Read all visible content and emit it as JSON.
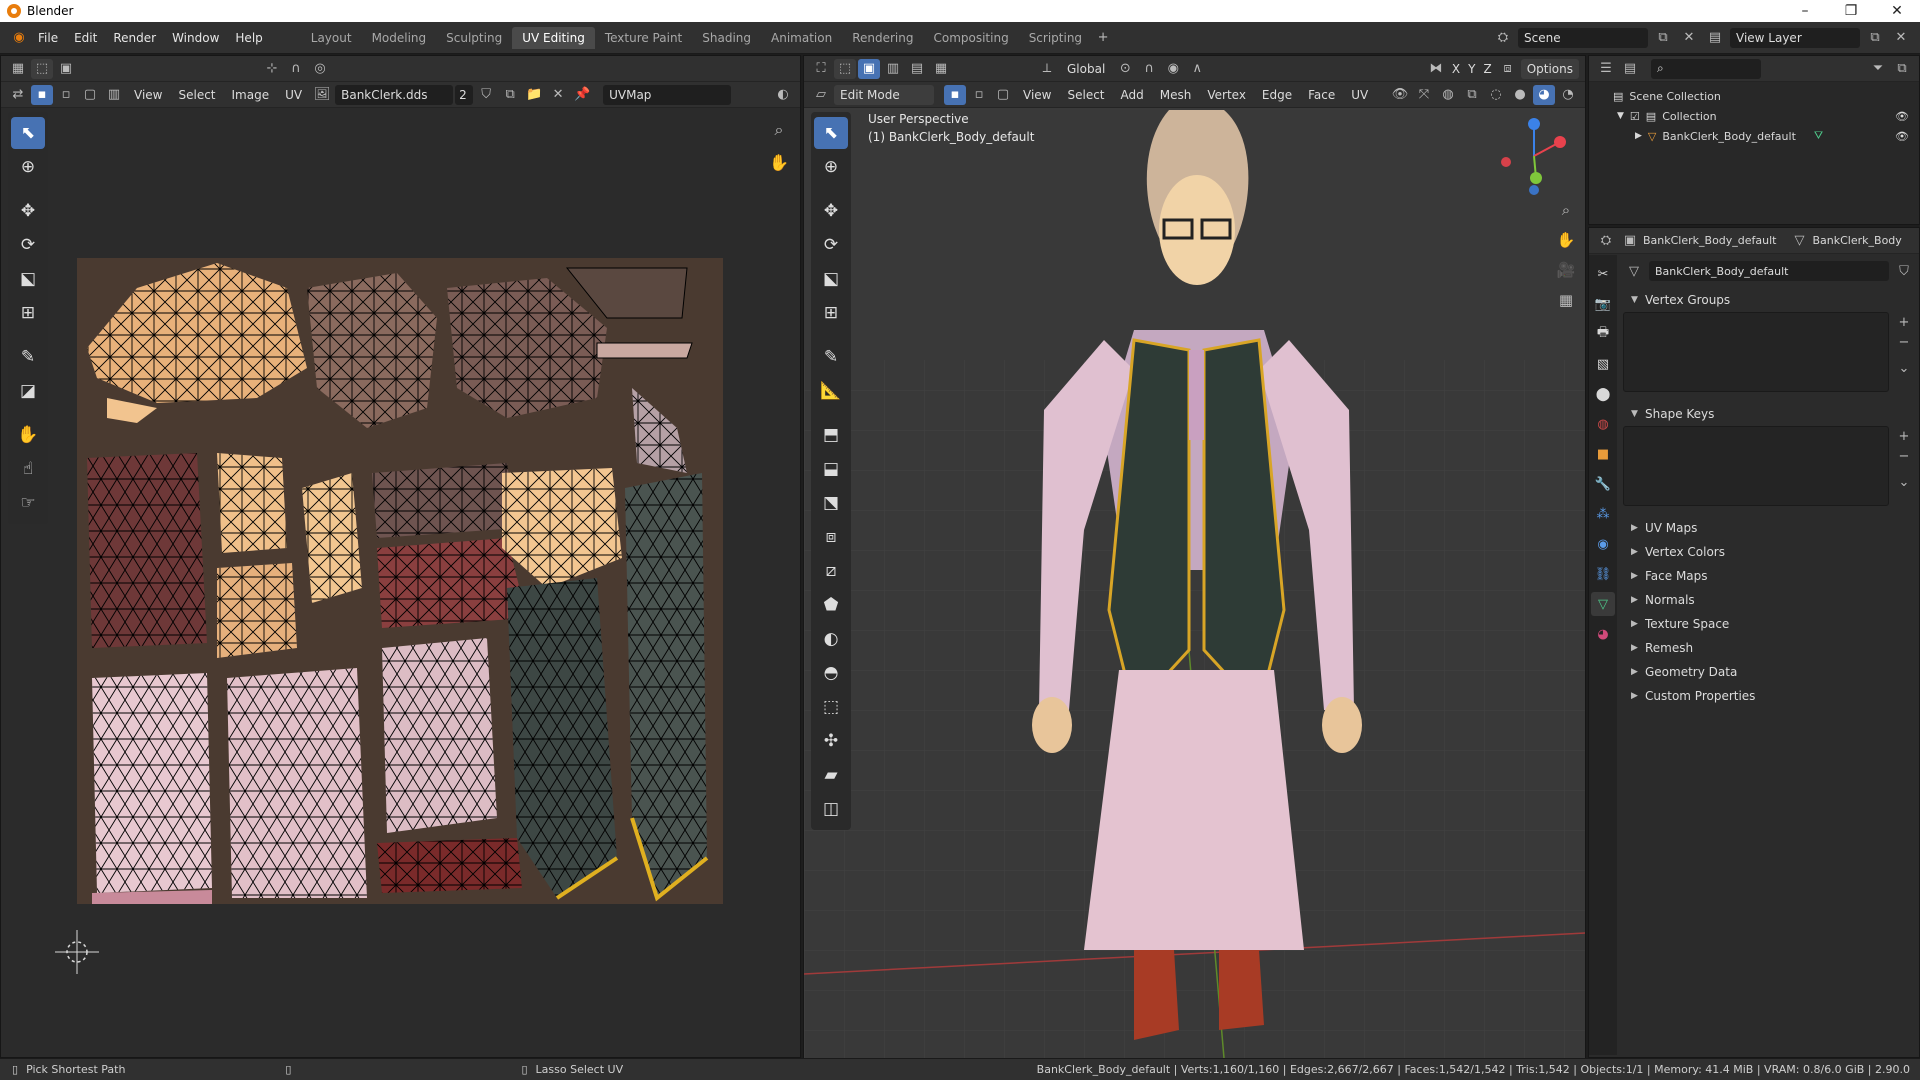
{
  "window": {
    "title": "Blender"
  },
  "menu": [
    "File",
    "Edit",
    "Render",
    "Window",
    "Help"
  ],
  "workspaces": [
    {
      "label": "Layout",
      "active": false
    },
    {
      "label": "Modeling",
      "active": false
    },
    {
      "label": "Sculpting",
      "active": false
    },
    {
      "label": "UV Editing",
      "active": true
    },
    {
      "label": "Texture Paint",
      "active": false
    },
    {
      "label": "Shading",
      "active": false
    },
    {
      "label": "Animation",
      "active": false
    },
    {
      "label": "Rendering",
      "active": false
    },
    {
      "label": "Compositing",
      "active": false
    },
    {
      "label": "Scripting",
      "active": false
    }
  ],
  "scene": {
    "label": "Scene",
    "view_layer": "View Layer"
  },
  "uv_editor": {
    "menus": [
      "View",
      "Select",
      "Image",
      "UV"
    ],
    "image_name": "BankClerk.dds",
    "image_users": "2",
    "uv_map": "UVMap"
  },
  "viewport": {
    "orientation": "Global",
    "options": "Options",
    "mode": "Edit Mode",
    "menus": [
      "View",
      "Select",
      "Add",
      "Mesh",
      "Vertex",
      "Edge",
      "Face",
      "UV"
    ],
    "overlay_line1": "User Perspective",
    "overlay_line2": "(1) BankClerk_Body_default",
    "axes": {
      "x": "X",
      "y": "Y",
      "z": "Z"
    }
  },
  "outliner": {
    "scene_collection": "Scene Collection",
    "collection": "Collection",
    "object": "BankClerk_Body_default"
  },
  "properties": {
    "breadcrumb_object": "BankClerk_Body_default",
    "breadcrumb_mesh": "BankClerk_Body",
    "mesh_name": "BankClerk_Body_default",
    "panels_open": [
      "Vertex Groups",
      "Shape Keys"
    ],
    "panels_closed": [
      "UV Maps",
      "Vertex Colors",
      "Face Maps",
      "Normals",
      "Texture Space",
      "Remesh",
      "Geometry Data",
      "Custom Properties"
    ]
  },
  "status": {
    "left": "Pick Shortest Path",
    "middle": "Lasso Select UV",
    "right": "BankClerk_Body_default | Verts:1,160/1,160 | Edges:2,667/2,667 | Faces:1,542/1,542 | Tris:1,542 | Objects:1/1 | Memory: 41.4 MiB | VRAM: 0.8/6.0 GiB | 2.90.0"
  },
  "colors": {
    "accent": "#4772b3",
    "x_axis": "#e8424d",
    "y_axis": "#7fc73b",
    "z_axis": "#3b82e8"
  }
}
